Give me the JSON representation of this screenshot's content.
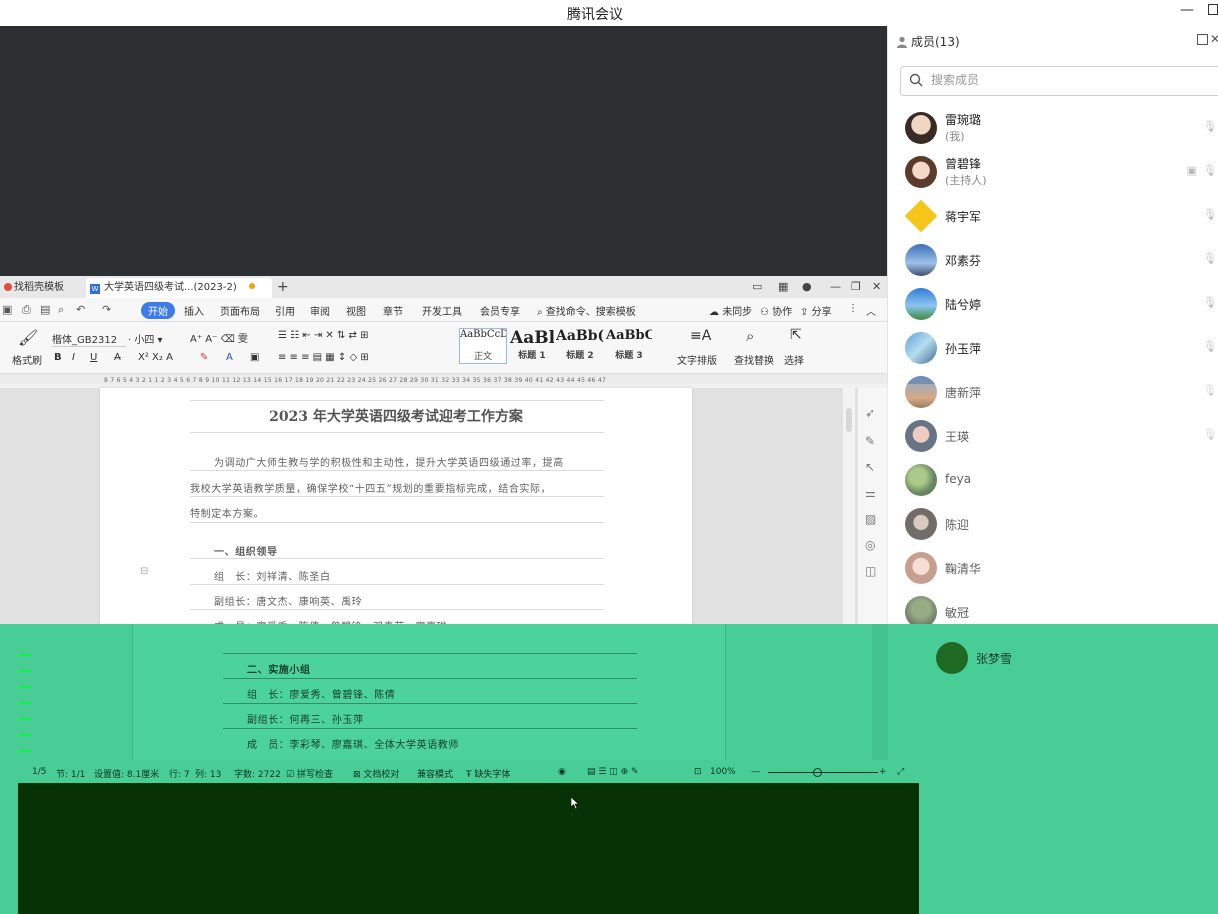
{
  "app": {
    "title": "腾讯会议",
    "min_label": "—"
  },
  "wps": {
    "tab_templates": "找稻壳模板",
    "tab_doc": "大学英语四级考试...(2023-2)",
    "tab_add": "+",
    "menu": [
      "开始",
      "插入",
      "页面布局",
      "引用",
      "审阅",
      "视图",
      "章节",
      "开发工具",
      "会员专享"
    ],
    "menu_active": "开始",
    "search_cmd": "查找命令、搜索模板",
    "sync": "未同步",
    "collab": "协作",
    "share": "分享",
    "font_name": "楷体_GB2312",
    "font_size": "小四",
    "format_painter": "格式刷",
    "styles": [
      {
        "sample": "AaBbCcDd",
        "name": "正文"
      },
      {
        "sample": "AaBl",
        "name": "标题 1"
      },
      {
        "sample": "AaBb(",
        "name": "标题 2"
      },
      {
        "sample": "AaBbC",
        "name": "标题 3"
      }
    ],
    "text_layout": "文字排版",
    "find_replace": "查找替换",
    "select": "选择",
    "ruler": "8 7 6 5 4 3 2 1 1 2 3 4 5 6 7 8 9 10 11 12 13 14 15 16 17 18 19 20 21 22 23 24 25 26 27 28 29 30 31 32 33 34 35 36 37 38 39 40 41 42 43 44 45 46 47"
  },
  "doc": {
    "title": "2023 年大学英语四级考试迎考工作方案",
    "para1": "为调动广大师生教与学的积极性和主动性，提升大学英语四级通过率，提高",
    "para2": "我校大学英语教学质量，确保学校“十四五”规划的重要指标完成，结合实际，",
    "para3": "特制定本方案。",
    "section1": "一、组织领导",
    "leader": "组　长：刘祥清、陈圣白",
    "deputy": "副组长：唐文杰、康响英、禹玲",
    "members": "成　员：廖爱秀、陈倩、曾碧锋、邓素芬、廖嘉琪",
    "section2": "二、实施小组",
    "leader2": "组　长：廖爱秀、曾碧锋、陈倩",
    "deputy2": "副组长：何再三、孙玉萍",
    "members2": "成　员：李彩琴、廖嘉琪、全体大学英语教师"
  },
  "status": {
    "page": "1/5",
    "section": "节: 1/1",
    "setting": "设置值: 8.1厘米",
    "row": "行: 7",
    "col": "列: 13",
    "words": "字数: 2722",
    "spell": "拼写检查",
    "proof": "文档校对",
    "compat": "兼容模式",
    "missing_font": "缺失字体",
    "zoom": "100%"
  },
  "members_panel": {
    "title": "成员(13)",
    "search_placeholder": "搜索成员",
    "members": [
      {
        "name": "雷琬璐",
        "role": "(我)"
      },
      {
        "name": "曾碧锋",
        "role": "(主持人)"
      },
      {
        "name": "蒋宇军",
        "role": ""
      },
      {
        "name": "邓素芬",
        "role": ""
      },
      {
        "name": "陆兮婷",
        "role": ""
      },
      {
        "name": "孙玉萍",
        "role": ""
      },
      {
        "name": "唐新萍",
        "role": ""
      },
      {
        "name": "王瑛",
        "role": ""
      },
      {
        "name": "feya",
        "role": ""
      },
      {
        "name": "陈迎",
        "role": ""
      },
      {
        "name": "鞠清华",
        "role": ""
      },
      {
        "name": "敏冠",
        "role": ""
      },
      {
        "name": "张梦雪",
        "role": ""
      }
    ]
  },
  "colors": {
    "accent": "#3c7be8",
    "glitch_green": "#48cd96",
    "glitch_dark": "#073206",
    "share_bg": "#2d3033"
  }
}
